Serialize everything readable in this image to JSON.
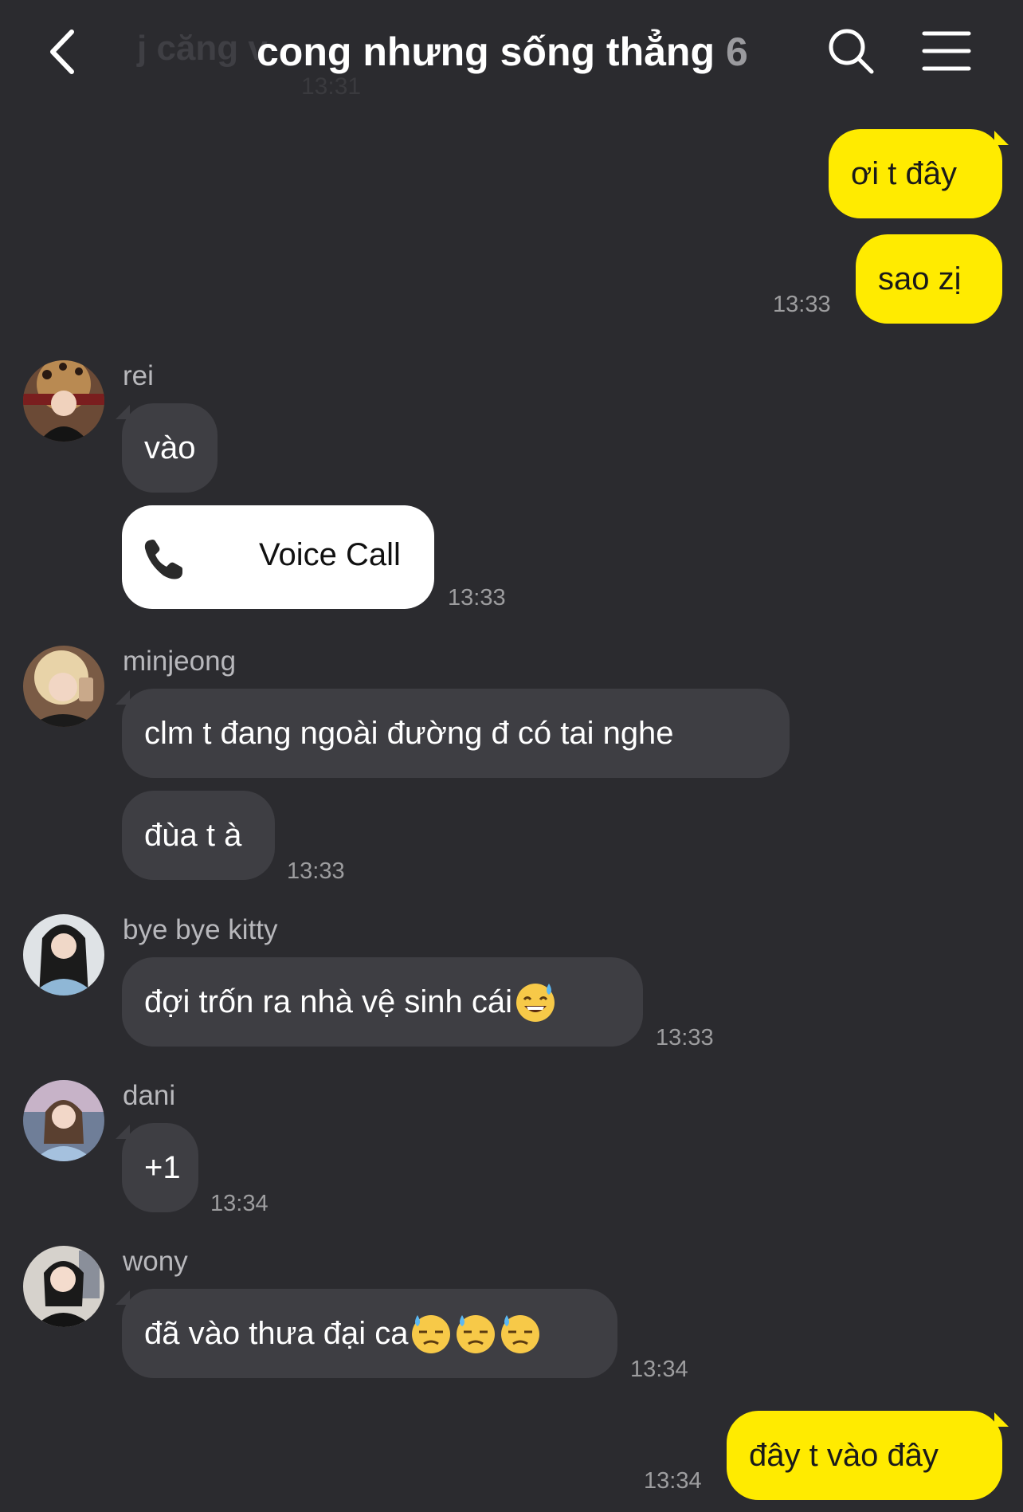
{
  "header": {
    "title": "cong nhưng sống thẳng",
    "member_count": "6",
    "ghost_message": "j căng v",
    "ghost_time": "13:31"
  },
  "messages": [
    {
      "text": "ơi t đây",
      "direction": "out"
    },
    {
      "text": "sao zị",
      "direction": "out",
      "time": "13:33"
    },
    {
      "sender": "rei",
      "text": "vào",
      "direction": "in"
    },
    {
      "call_label": "Voice Call",
      "time": "13:33"
    },
    {
      "sender": "minjeong",
      "text": "clm t đang ngoài đường đ có tai nghe",
      "direction": "in"
    },
    {
      "text": "đùa t à",
      "direction": "in",
      "time": "13:33"
    },
    {
      "sender": "bye bye kitty",
      "text": "đợi trốn ra nhà vệ sinh cái",
      "emoji": "sweat-smile-emoji",
      "direction": "in",
      "time": "13:33"
    },
    {
      "sender": "dani",
      "text": "+1",
      "direction": "in",
      "time": "13:34"
    },
    {
      "sender": "wony",
      "text": "đã vào thưa đại ca",
      "emoji": "downcast-sweat-emoji",
      "direction": "in",
      "time": "13:34"
    },
    {
      "text": "đây t vào đây",
      "direction": "out",
      "time": "13:34"
    }
  ],
  "colors": {
    "background": "#2b2b2f",
    "outgoing_bubble": "#ffeb00",
    "incoming_bubble": "#3e3e43",
    "timestamp": "#9d9d9f"
  }
}
